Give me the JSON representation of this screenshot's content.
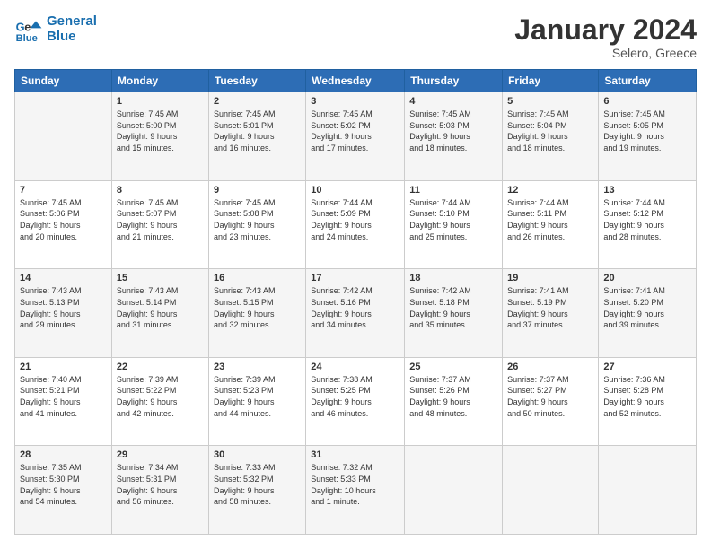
{
  "header": {
    "logo_line1": "General",
    "logo_line2": "Blue",
    "month_year": "January 2024",
    "location": "Selero, Greece"
  },
  "days_of_week": [
    "Sunday",
    "Monday",
    "Tuesday",
    "Wednesday",
    "Thursday",
    "Friday",
    "Saturday"
  ],
  "weeks": [
    [
      {
        "day": "",
        "info": ""
      },
      {
        "day": "1",
        "info": "Sunrise: 7:45 AM\nSunset: 5:00 PM\nDaylight: 9 hours\nand 15 minutes."
      },
      {
        "day": "2",
        "info": "Sunrise: 7:45 AM\nSunset: 5:01 PM\nDaylight: 9 hours\nand 16 minutes."
      },
      {
        "day": "3",
        "info": "Sunrise: 7:45 AM\nSunset: 5:02 PM\nDaylight: 9 hours\nand 17 minutes."
      },
      {
        "day": "4",
        "info": "Sunrise: 7:45 AM\nSunset: 5:03 PM\nDaylight: 9 hours\nand 18 minutes."
      },
      {
        "day": "5",
        "info": "Sunrise: 7:45 AM\nSunset: 5:04 PM\nDaylight: 9 hours\nand 18 minutes."
      },
      {
        "day": "6",
        "info": "Sunrise: 7:45 AM\nSunset: 5:05 PM\nDaylight: 9 hours\nand 19 minutes."
      }
    ],
    [
      {
        "day": "7",
        "info": "Sunrise: 7:45 AM\nSunset: 5:06 PM\nDaylight: 9 hours\nand 20 minutes."
      },
      {
        "day": "8",
        "info": "Sunrise: 7:45 AM\nSunset: 5:07 PM\nDaylight: 9 hours\nand 21 minutes."
      },
      {
        "day": "9",
        "info": "Sunrise: 7:45 AM\nSunset: 5:08 PM\nDaylight: 9 hours\nand 23 minutes."
      },
      {
        "day": "10",
        "info": "Sunrise: 7:44 AM\nSunset: 5:09 PM\nDaylight: 9 hours\nand 24 minutes."
      },
      {
        "day": "11",
        "info": "Sunrise: 7:44 AM\nSunset: 5:10 PM\nDaylight: 9 hours\nand 25 minutes."
      },
      {
        "day": "12",
        "info": "Sunrise: 7:44 AM\nSunset: 5:11 PM\nDaylight: 9 hours\nand 26 minutes."
      },
      {
        "day": "13",
        "info": "Sunrise: 7:44 AM\nSunset: 5:12 PM\nDaylight: 9 hours\nand 28 minutes."
      }
    ],
    [
      {
        "day": "14",
        "info": "Sunrise: 7:43 AM\nSunset: 5:13 PM\nDaylight: 9 hours\nand 29 minutes."
      },
      {
        "day": "15",
        "info": "Sunrise: 7:43 AM\nSunset: 5:14 PM\nDaylight: 9 hours\nand 31 minutes."
      },
      {
        "day": "16",
        "info": "Sunrise: 7:43 AM\nSunset: 5:15 PM\nDaylight: 9 hours\nand 32 minutes."
      },
      {
        "day": "17",
        "info": "Sunrise: 7:42 AM\nSunset: 5:16 PM\nDaylight: 9 hours\nand 34 minutes."
      },
      {
        "day": "18",
        "info": "Sunrise: 7:42 AM\nSunset: 5:18 PM\nDaylight: 9 hours\nand 35 minutes."
      },
      {
        "day": "19",
        "info": "Sunrise: 7:41 AM\nSunset: 5:19 PM\nDaylight: 9 hours\nand 37 minutes."
      },
      {
        "day": "20",
        "info": "Sunrise: 7:41 AM\nSunset: 5:20 PM\nDaylight: 9 hours\nand 39 minutes."
      }
    ],
    [
      {
        "day": "21",
        "info": "Sunrise: 7:40 AM\nSunset: 5:21 PM\nDaylight: 9 hours\nand 41 minutes."
      },
      {
        "day": "22",
        "info": "Sunrise: 7:39 AM\nSunset: 5:22 PM\nDaylight: 9 hours\nand 42 minutes."
      },
      {
        "day": "23",
        "info": "Sunrise: 7:39 AM\nSunset: 5:23 PM\nDaylight: 9 hours\nand 44 minutes."
      },
      {
        "day": "24",
        "info": "Sunrise: 7:38 AM\nSunset: 5:25 PM\nDaylight: 9 hours\nand 46 minutes."
      },
      {
        "day": "25",
        "info": "Sunrise: 7:37 AM\nSunset: 5:26 PM\nDaylight: 9 hours\nand 48 minutes."
      },
      {
        "day": "26",
        "info": "Sunrise: 7:37 AM\nSunset: 5:27 PM\nDaylight: 9 hours\nand 50 minutes."
      },
      {
        "day": "27",
        "info": "Sunrise: 7:36 AM\nSunset: 5:28 PM\nDaylight: 9 hours\nand 52 minutes."
      }
    ],
    [
      {
        "day": "28",
        "info": "Sunrise: 7:35 AM\nSunset: 5:30 PM\nDaylight: 9 hours\nand 54 minutes."
      },
      {
        "day": "29",
        "info": "Sunrise: 7:34 AM\nSunset: 5:31 PM\nDaylight: 9 hours\nand 56 minutes."
      },
      {
        "day": "30",
        "info": "Sunrise: 7:33 AM\nSunset: 5:32 PM\nDaylight: 9 hours\nand 58 minutes."
      },
      {
        "day": "31",
        "info": "Sunrise: 7:32 AM\nSunset: 5:33 PM\nDaylight: 10 hours\nand 1 minute."
      },
      {
        "day": "",
        "info": ""
      },
      {
        "day": "",
        "info": ""
      },
      {
        "day": "",
        "info": ""
      }
    ]
  ]
}
